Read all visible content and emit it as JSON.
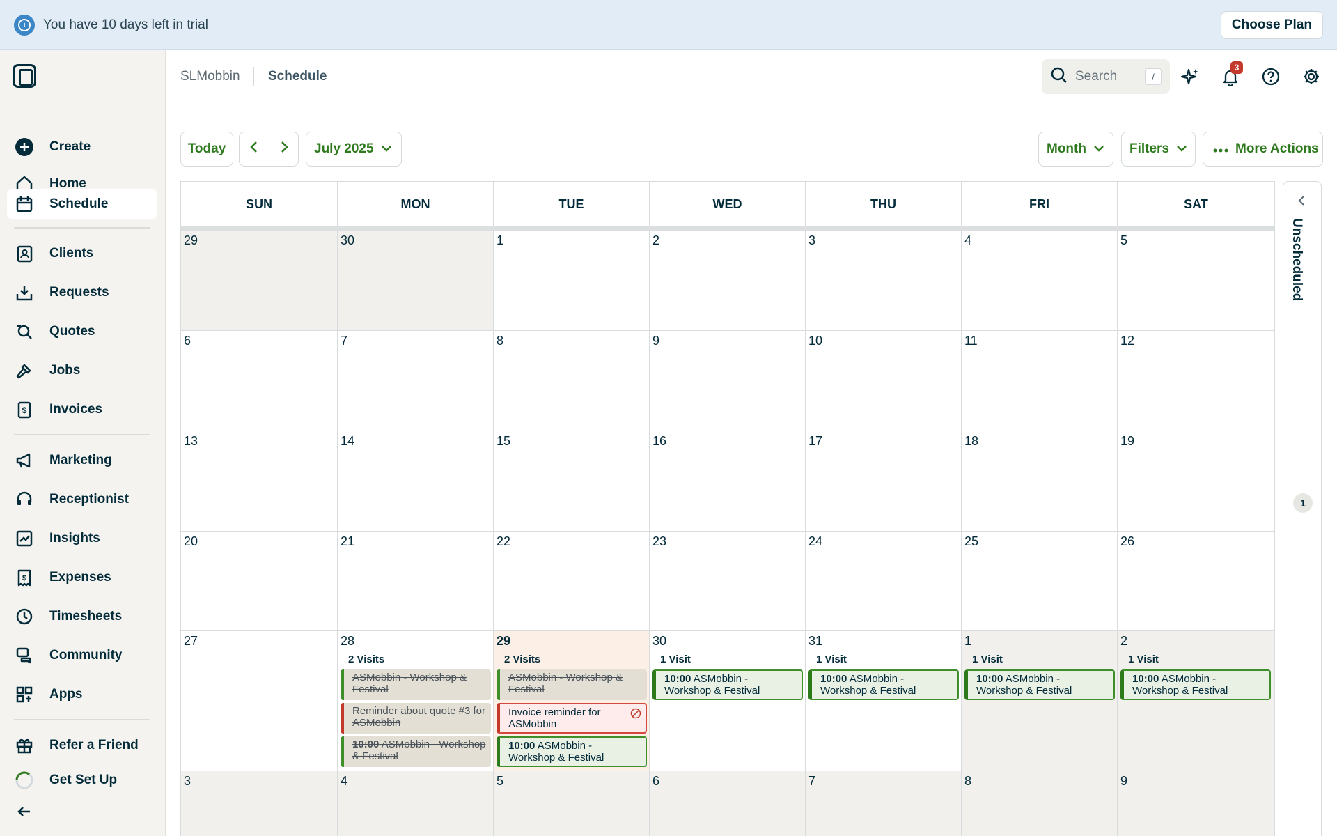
{
  "trial_banner": {
    "message": "You have 10 days left in trial",
    "button": "Choose Plan"
  },
  "sidebar": {
    "items": [
      {
        "label": "Create",
        "icon": "plus-circle-icon"
      },
      {
        "label": "Home",
        "icon": "home-icon"
      },
      {
        "label": "Schedule",
        "icon": "calendar-icon",
        "active": true
      },
      {
        "label": "Clients",
        "icon": "contacts-icon"
      },
      {
        "label": "Requests",
        "icon": "inbox-download-icon"
      },
      {
        "label": "Quotes",
        "icon": "quote-search-icon"
      },
      {
        "label": "Jobs",
        "icon": "hammer-icon"
      },
      {
        "label": "Invoices",
        "icon": "invoice-dollar-icon"
      },
      {
        "label": "Marketing",
        "icon": "megaphone-icon"
      },
      {
        "label": "Receptionist",
        "icon": "headset-icon"
      },
      {
        "label": "Insights",
        "icon": "chart-icon"
      },
      {
        "label": "Expenses",
        "icon": "receipt-dollar-icon"
      },
      {
        "label": "Timesheets",
        "icon": "clock-icon"
      },
      {
        "label": "Community",
        "icon": "chat-bubbles-icon"
      },
      {
        "label": "Apps",
        "icon": "apps-grid-icon"
      },
      {
        "label": "Refer a Friend",
        "icon": "gift-icon"
      },
      {
        "label": "Get Set Up",
        "icon": "progress-ring-icon"
      }
    ]
  },
  "header": {
    "company": "SLMobbin",
    "page_title": "Schedule",
    "search_placeholder": "Search",
    "search_shortcut": "/",
    "notification_count": "3"
  },
  "toolbar": {
    "today": "Today",
    "month_label": "July 2025",
    "view": "Month",
    "filters": "Filters",
    "more_actions": "More Actions"
  },
  "calendar": {
    "weekdays": [
      "SUN",
      "MON",
      "TUE",
      "WED",
      "THU",
      "FRI",
      "SAT"
    ],
    "weeks": [
      [
        "29",
        "30",
        "1",
        "2",
        "3",
        "4",
        "5"
      ],
      [
        "6",
        "7",
        "8",
        "9",
        "10",
        "11",
        "12"
      ],
      [
        "13",
        "14",
        "15",
        "16",
        "17",
        "18",
        "19"
      ],
      [
        "20",
        "21",
        "22",
        "23",
        "24",
        "25",
        "26"
      ],
      [
        "27",
        "28",
        "29",
        "30",
        "31",
        "1",
        "2"
      ],
      [
        "3",
        "4",
        "5",
        "6",
        "7",
        "8",
        "9"
      ]
    ],
    "visit_counts": {
      "mon28": "2 Visits",
      "tue29": "2 Visits",
      "wed30": "1 Visit",
      "thu31": "1 Visit",
      "fri1": "1 Visit",
      "sat2": "1 Visit"
    },
    "events": {
      "mon28_a": "ASMobbin - Workshop & Festival",
      "mon28_b": "Reminder about quote #3 for ASMobbin",
      "mon28_c_time": "10:00",
      "mon28_c_title": "ASMobbin - Workshop & Festival",
      "tue29_a": "ASMobbin - Workshop & Festival",
      "tue29_b": "Invoice reminder for ASMobbin",
      "tue29_c_time": "10:00",
      "tue29_c_title": "ASMobbin - Workshop & Festival",
      "wed30_time": "10:00",
      "wed30_title": "ASMobbin - Workshop & Festival",
      "thu31_time": "10:00",
      "thu31_title": "ASMobbin - Workshop & Festival",
      "fri1_time": "10:00",
      "fri1_title": "ASMobbin - Workshop & Festival",
      "sat2_time": "10:00",
      "sat2_title": "ASMobbin - Workshop & Festival"
    }
  },
  "unscheduled": {
    "label": "Unscheduled",
    "count": "1"
  },
  "colors": {
    "brand_green": "#2f7a1f",
    "navy": "#032b3a",
    "alert_red": "#c33a2d",
    "banner_blue": "#e2ecf6"
  }
}
